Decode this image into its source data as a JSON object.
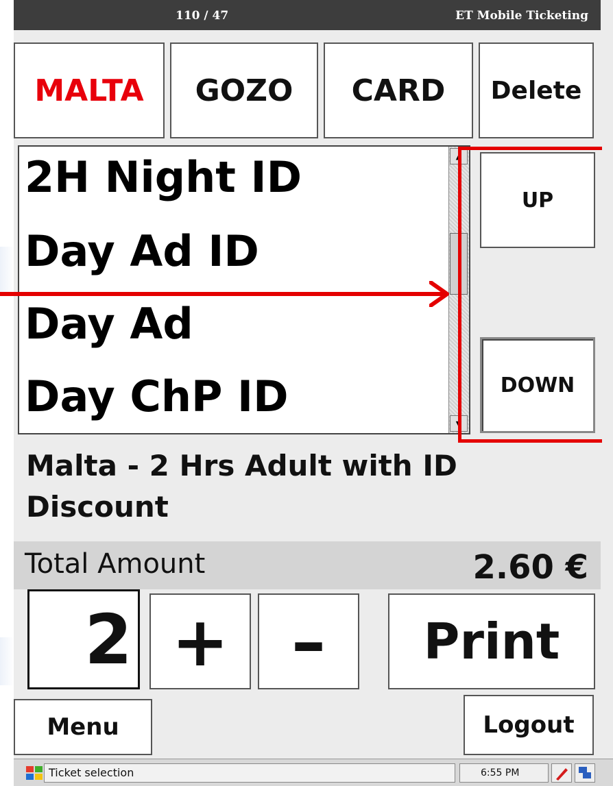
{
  "titlebar": {
    "counter": "110 / 47",
    "app_title": "ET Mobile Ticketing"
  },
  "tabs": [
    {
      "label": "MALTA",
      "color": "#e8000b"
    },
    {
      "label": "GOZO"
    },
    {
      "label": "CARD"
    },
    {
      "label": "Delete"
    }
  ],
  "ticket_list": {
    "items": [
      "2H Night ID",
      "Day Ad ID",
      "Day Ad",
      "Day ChP ID"
    ]
  },
  "nav": {
    "up_label": "UP",
    "down_label": "DOWN"
  },
  "selection_description": "Malta - 2 Hrs Adult with ID Discount",
  "total": {
    "label": "Total Amount",
    "value": "2.60 €"
  },
  "quantity": {
    "value": "2",
    "plus_label": "+",
    "minus_label": "–"
  },
  "print_label": "Print",
  "menu_label": "Menu",
  "logout_label": "Logout",
  "statusbar": {
    "task_label": "Ticket selection",
    "time": "6:55 PM"
  },
  "colors": {
    "annotation": "#e40000",
    "title_bg": "#3d3d3d"
  }
}
